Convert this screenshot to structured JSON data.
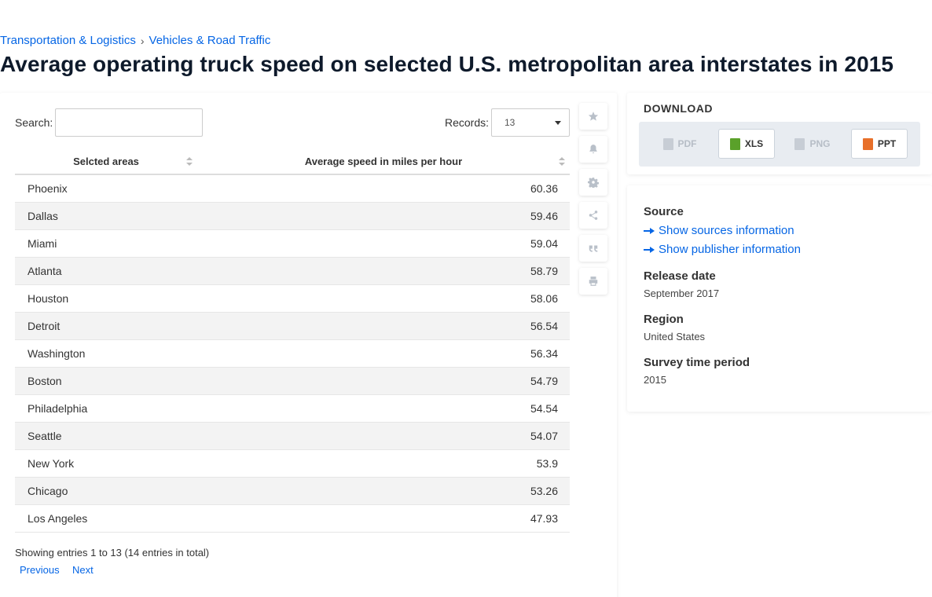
{
  "breadcrumb": {
    "items": [
      "Transportation & Logistics",
      "Vehicles & Road Traffic"
    ],
    "separator": "›"
  },
  "page": {
    "title": "Average operating truck speed on selected U.S. metropolitan area interstates in 2015"
  },
  "controls": {
    "search_label": "Search:",
    "search_value": "",
    "records_label": "Records:",
    "records_value": "13"
  },
  "table": {
    "headers": [
      "Selcted areas",
      "Average speed in miles per hour"
    ],
    "rows": [
      {
        "area": "Phoenix",
        "value": "60.36"
      },
      {
        "area": "Dallas",
        "value": "59.46"
      },
      {
        "area": "Miami",
        "value": "59.04"
      },
      {
        "area": "Atlanta",
        "value": "58.79"
      },
      {
        "area": "Houston",
        "value": "58.06"
      },
      {
        "area": "Detroit",
        "value": "56.54"
      },
      {
        "area": "Washington",
        "value": "56.34"
      },
      {
        "area": "Boston",
        "value": "54.79"
      },
      {
        "area": "Philadelphia",
        "value": "54.54"
      },
      {
        "area": "Seattle",
        "value": "54.07"
      },
      {
        "area": "New York",
        "value": "53.9"
      },
      {
        "area": "Chicago",
        "value": "53.26"
      },
      {
        "area": "Los Angeles",
        "value": "47.93"
      }
    ]
  },
  "pagination": {
    "summary": "Showing entries 1 to 13 (14 entries in total)",
    "prev": "Previous",
    "next": "Next"
  },
  "toolbar": {
    "icons": [
      "star-icon",
      "bell-icon",
      "gear-icon",
      "share-icon",
      "quote-icon",
      "print-icon"
    ]
  },
  "download": {
    "title": "DOWNLOAD",
    "buttons": [
      {
        "label": "PDF",
        "enabled": false
      },
      {
        "label": "XLS",
        "enabled": true
      },
      {
        "label": "PNG",
        "enabled": false
      },
      {
        "label": "PPT",
        "enabled": true
      }
    ]
  },
  "info": {
    "source_heading": "Source",
    "sources_link": "Show sources information",
    "publisher_link": "Show publisher information",
    "release_heading": "Release date",
    "release_value": "September 2017",
    "region_heading": "Region",
    "region_value": "United States",
    "period_heading": "Survey time period",
    "period_value": "2015"
  },
  "colors": {
    "link": "#0666e5",
    "title": "#0e1a2b",
    "xls_icon": "#5aa12a",
    "ppt_icon": "#e8702a"
  }
}
